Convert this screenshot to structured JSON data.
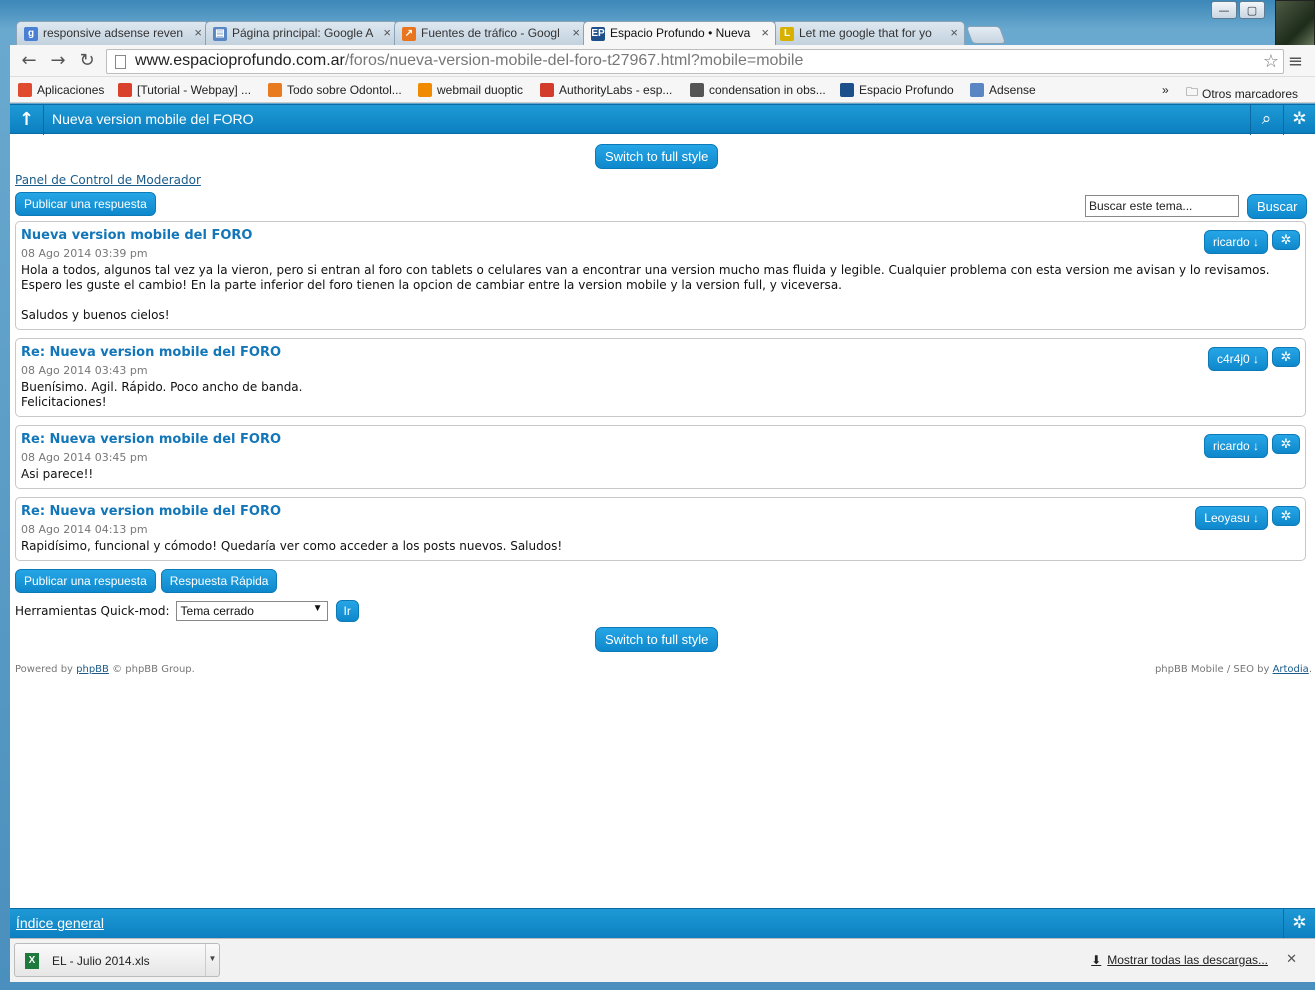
{
  "browser": {
    "tabs": [
      {
        "title": "responsive adsense reven",
        "favicon": "g",
        "favicon_color": "#4a7fd4",
        "active": false
      },
      {
        "title": "Página principal: Google A",
        "favicon": "▤",
        "favicon_color": "#5b86c4",
        "active": false
      },
      {
        "title": "Fuentes de tráfico - Googl",
        "favicon": "↗",
        "favicon_color": "#e8741e",
        "active": false
      },
      {
        "title": "Espacio Profundo • Nueva",
        "favicon": "EP",
        "favicon_color": "#1d4f8a",
        "active": true
      },
      {
        "title": "Let me google that for yo",
        "favicon": "L",
        "favicon_color": "#d8b100",
        "active": false
      }
    ],
    "url_host": "www.espacioprofundo.com.ar",
    "url_path": "/foros/nueva-version-mobile-del-foro-t27967.html?mobile=mobile",
    "bookmarks": [
      {
        "label": "Aplicaciones",
        "icon": "apps-icon",
        "color": "#e04a2f"
      },
      {
        "label": "[Tutorial - Webpay] ...",
        "icon": "webpay-icon",
        "color": "#d9412c"
      },
      {
        "label": "Todo sobre Odontol...",
        "icon": "joomla-icon",
        "color": "#e87a1f"
      },
      {
        "label": "webmail duoptic",
        "icon": "cpanel-icon",
        "color": "#f08a00"
      },
      {
        "label": "AuthorityLabs - esp...",
        "icon": "authoritylabs-icon",
        "color": "#d33c2b"
      },
      {
        "label": "condensation in obs...",
        "icon": "page-icon",
        "color": "#555555"
      },
      {
        "label": "Espacio Profundo",
        "icon": "espacio-icon",
        "color": "#1d4f8a"
      },
      {
        "label": "Adsense",
        "icon": "adsense-icon",
        "color": "#5b86c4"
      }
    ],
    "bookmarks_overflow": "»",
    "other_bookmarks": "Otros marcadores"
  },
  "header": {
    "title": "Nueva version mobile del FORO"
  },
  "switch_label": "Switch to full style",
  "mod_panel_link": "Panel de Control de Moderador",
  "reply_label": "Publicar una respuesta",
  "quick_reply_label": "Respuesta Rápida",
  "search": {
    "placeholder": "Buscar este tema...",
    "button": "Buscar"
  },
  "posts": [
    {
      "title": "Nueva version mobile del FORO",
      "date": "08 Ago 2014 03:39 pm",
      "user": "ricardo ↓",
      "body_lines": [
        "Hola a todos, algunos tal vez ya la vieron, pero si entran al foro con tablets o celulares van a encontrar una version mucho mas fluida y legible. Cualquier problema con esta version me avisan y lo revisamos. Espero les guste el cambio! En la parte inferior del foro tienen la opcion de cambiar entre la version mobile y la version full, y viceversa.",
        "",
        "Saludos y buenos cielos!"
      ]
    },
    {
      "title": "Re: Nueva version mobile del FORO",
      "date": "08 Ago 2014 03:43 pm",
      "user": "c4r4j0 ↓",
      "body_lines": [
        "Buenísimo. Agil. Rápido. Poco ancho de banda.",
        "Felicitaciones!"
      ]
    },
    {
      "title": "Re: Nueva version mobile del FORO",
      "date": "08 Ago 2014 03:45 pm",
      "user": "ricardo ↓",
      "body_lines": [
        "Asi parece!!"
      ]
    },
    {
      "title": "Re: Nueva version mobile del FORO",
      "date": "08 Ago 2014 04:13 pm",
      "user": "Leoyasu ↓",
      "body_lines": [
        "Rapidísimo, funcional y cómodo! Quedaría ver como acceder a los posts nuevos. Saludos!"
      ]
    }
  ],
  "quickmod": {
    "label": "Herramientas Quick-mod:",
    "selected": "Tema cerrado",
    "go": "Ir"
  },
  "footer": {
    "powered_prefix": "Powered by ",
    "powered_link": "phpBB",
    "powered_suffix": " © phpBB Group.",
    "seo_prefix": "phpBB Mobile / SEO by ",
    "seo_link": "Artodia",
    "seo_suffix": "."
  },
  "bottom_nav": {
    "index_link": "Índice general"
  },
  "downloads": {
    "file_name": "EL - Julio 2014.xls",
    "show_all": "Mostrar todas las descargas..."
  },
  "colors": {
    "accent": "#0e88cc",
    "title_blue": "#1276b8"
  }
}
